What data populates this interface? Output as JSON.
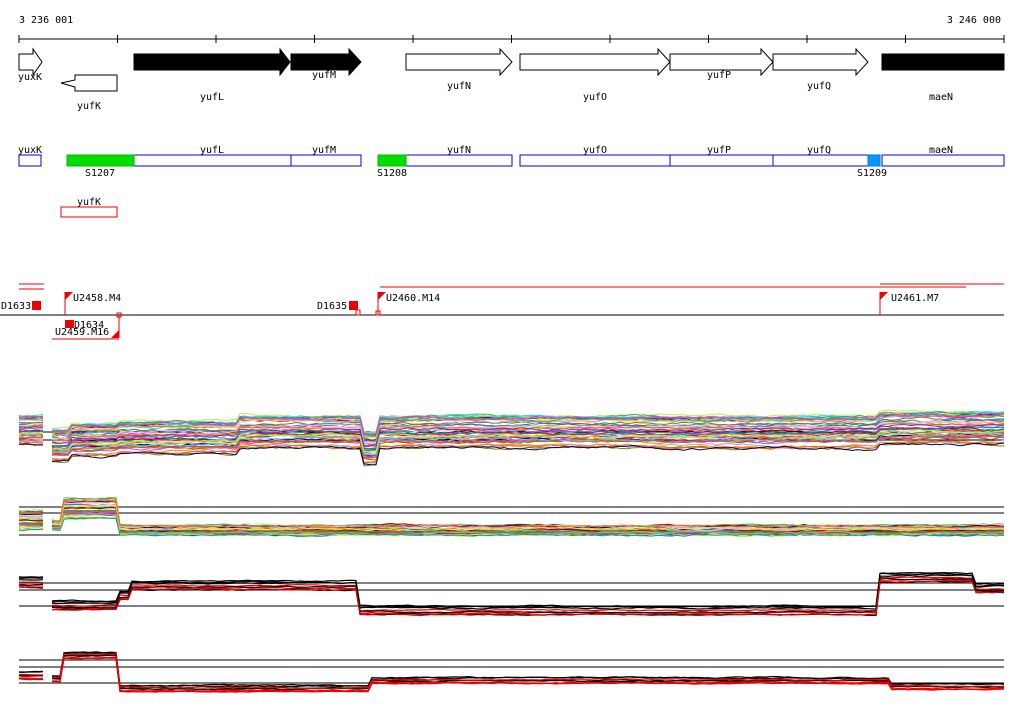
{
  "coords": {
    "start": "3 236 001",
    "end": "3 246 000"
  },
  "colors": {
    "black": "#000000",
    "blue": "#0000dd",
    "red": "#ee0000",
    "green": "#00dd00",
    "lightblue": "#0099ff",
    "white": "#ffffff"
  },
  "genes_arrows": [
    {
      "name": "yuxK",
      "strand": "+",
      "fill": "white"
    },
    {
      "name": "yufK",
      "strand": "-",
      "fill": "white"
    },
    {
      "name": "yufL",
      "strand": "+",
      "fill": "black"
    },
    {
      "name": "yufM",
      "strand": "+",
      "fill": "black"
    },
    {
      "name": "yufN",
      "strand": "+",
      "fill": "white"
    },
    {
      "name": "yufO",
      "strand": "+",
      "fill": "white"
    },
    {
      "name": "yufP",
      "strand": "+",
      "fill": "white"
    },
    {
      "name": "yufQ",
      "strand": "+",
      "fill": "white"
    },
    {
      "name": "maeN",
      "strand": "+",
      "fill": "black"
    }
  ],
  "gene_boxes_plus": [
    "yuxK",
    "yufL",
    "yufM",
    "yufN",
    "yufO",
    "yufP",
    "yufQ",
    "maeN"
  ],
  "gene_boxes_minus": [
    "yufK"
  ],
  "segments": [
    {
      "label": "S1207",
      "color": "green"
    },
    {
      "label": "S1208",
      "color": "green"
    },
    {
      "label": "S1209",
      "color": "lightblue"
    }
  ],
  "features_plus": [
    {
      "label": "D1633"
    },
    {
      "label": "U2458.M4"
    },
    {
      "label": "D1635"
    },
    {
      "label": "U2460.M14"
    },
    {
      "label": "U2461.M7"
    }
  ],
  "features_minus": [
    {
      "label": "D1634"
    },
    {
      "label": "U2459.M16"
    }
  ]
}
